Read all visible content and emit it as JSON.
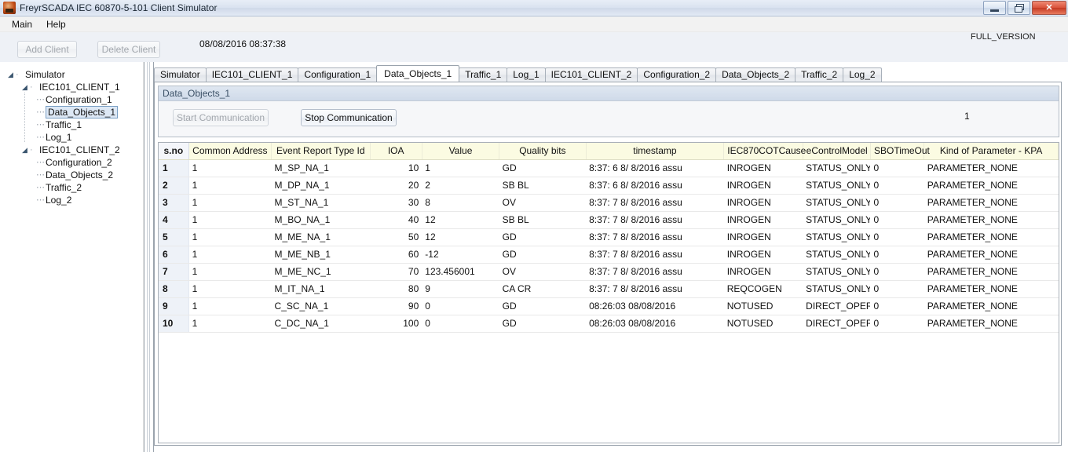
{
  "window": {
    "title": "FreyrSCADA IEC 60870-5-101 Client Simulator",
    "icon": "app-icon",
    "buttons": {
      "minimize": "minimize-icon",
      "restore": "restore-icon",
      "close": "✕"
    }
  },
  "menubar": {
    "items": [
      {
        "label": "Main"
      },
      {
        "label": "Help"
      }
    ]
  },
  "toolbar": {
    "add_client_label": "Add Client",
    "delete_client_label": "Delete Client",
    "datetime": "08/08/2016 08:37:38",
    "version_badge": "FULL_VERSION"
  },
  "tree": {
    "root": "Simulator",
    "nodes": [
      {
        "label": "Simulator",
        "level": 0,
        "expander": "◢",
        "selected": false
      },
      {
        "label": "IEC101_CLIENT_1",
        "level": 1,
        "expander": "◢",
        "selected": false
      },
      {
        "label": "Configuration_1",
        "level": 2,
        "expander": "",
        "selected": false
      },
      {
        "label": "Data_Objects_1",
        "level": 2,
        "expander": "",
        "selected": true
      },
      {
        "label": "Traffic_1",
        "level": 2,
        "expander": "",
        "selected": false
      },
      {
        "label": "Log_1",
        "level": 2,
        "expander": "",
        "selected": false
      },
      {
        "label": "IEC101_CLIENT_2",
        "level": 1,
        "expander": "◢",
        "selected": false
      },
      {
        "label": "Configuration_2",
        "level": 2,
        "expander": "",
        "selected": false
      },
      {
        "label": "Data_Objects_2",
        "level": 2,
        "expander": "",
        "selected": false
      },
      {
        "label": "Traffic_2",
        "level": 2,
        "expander": "",
        "selected": false
      },
      {
        "label": "Log_2",
        "level": 2,
        "expander": "",
        "selected": false
      }
    ]
  },
  "tabs": {
    "active": "Data_Objects_1",
    "items": [
      {
        "label": "Simulator",
        "active": false
      },
      {
        "label": "IEC101_CLIENT_1",
        "active": false
      },
      {
        "label": "Configuration_1",
        "active": false
      },
      {
        "label": "Data_Objects_1",
        "active": true
      },
      {
        "label": "Traffic_1",
        "active": false
      },
      {
        "label": "Log_1",
        "active": false
      },
      {
        "label": "IEC101_CLIENT_2",
        "active": false
      },
      {
        "label": "Configuration_2",
        "active": false
      },
      {
        "label": "Data_Objects_2",
        "active": false
      },
      {
        "label": "Traffic_2",
        "active": false
      },
      {
        "label": "Log_2",
        "active": false
      }
    ]
  },
  "panel": {
    "group_title": "Data_Objects_1",
    "start_button": "Start Communication",
    "start_button_disabled": true,
    "stop_button": "Stop Communication",
    "stop_button_disabled": false,
    "connection_count": "1"
  },
  "grid": {
    "columns": [
      "s.no",
      "Common Address",
      "Event Report Type Id",
      "IOA",
      "Value",
      "Quality bits",
      "timestamp",
      "IEC870COTCause",
      "eControlModel",
      "SBOTimeOut",
      "Kind of Parameter - KPA"
    ],
    "rows": [
      {
        "sno": "1",
        "ca": "1",
        "type": "M_SP_NA_1",
        "ioa": "10",
        "value": "1",
        "quality": "GD",
        "timestamp": "8:37: 6  8/ 8/2016 assu",
        "cot": "INROGEN",
        "ecm": "STATUS_ONLY",
        "sbo": "0",
        "kpa": "PARAMETER_NONE"
      },
      {
        "sno": "2",
        "ca": "1",
        "type": "M_DP_NA_1",
        "ioa": "20",
        "value": "2",
        "quality": "SB BL",
        "timestamp": "8:37: 6  8/ 8/2016 assu",
        "cot": "INROGEN",
        "ecm": "STATUS_ONLY",
        "sbo": "0",
        "kpa": "PARAMETER_NONE"
      },
      {
        "sno": "3",
        "ca": "1",
        "type": "M_ST_NA_1",
        "ioa": "30",
        "value": "8",
        "quality": "OV",
        "timestamp": "8:37: 7  8/ 8/2016 assu",
        "cot": "INROGEN",
        "ecm": "STATUS_ONLY",
        "sbo": "0",
        "kpa": "PARAMETER_NONE"
      },
      {
        "sno": "4",
        "ca": "1",
        "type": "M_BO_NA_1",
        "ioa": "40",
        "value": "12",
        "quality": "SB BL",
        "timestamp": "8:37: 7  8/ 8/2016 assu",
        "cot": "INROGEN",
        "ecm": "STATUS_ONLY",
        "sbo": "0",
        "kpa": "PARAMETER_NONE"
      },
      {
        "sno": "5",
        "ca": "1",
        "type": "M_ME_NA_1",
        "ioa": "50",
        "value": "12",
        "quality": "GD",
        "timestamp": "8:37: 7  8/ 8/2016 assu",
        "cot": "INROGEN",
        "ecm": "STATUS_ONLY",
        "sbo": "0",
        "kpa": "PARAMETER_NONE"
      },
      {
        "sno": "6",
        "ca": "1",
        "type": "M_ME_NB_1",
        "ioa": "60",
        "value": "-12",
        "quality": "GD",
        "timestamp": "8:37: 7  8/ 8/2016 assu",
        "cot": "INROGEN",
        "ecm": "STATUS_ONLY",
        "sbo": "0",
        "kpa": "PARAMETER_NONE"
      },
      {
        "sno": "7",
        "ca": "1",
        "type": "M_ME_NC_1",
        "ioa": "70",
        "value": "123.456001",
        "quality": "OV",
        "timestamp": "8:37: 7  8/ 8/2016 assu",
        "cot": "INROGEN",
        "ecm": "STATUS_ONLY",
        "sbo": "0",
        "kpa": "PARAMETER_NONE"
      },
      {
        "sno": "8",
        "ca": "1",
        "type": "M_IT_NA_1",
        "ioa": "80",
        "value": "9",
        "quality": "CA CR",
        "timestamp": "8:37: 7  8/ 8/2016 assu",
        "cot": "REQCOGEN",
        "ecm": "STATUS_ONLY",
        "sbo": "0",
        "kpa": "PARAMETER_NONE"
      },
      {
        "sno": "9",
        "ca": "1",
        "type": "C_SC_NA_1",
        "ioa": "90",
        "value": "0",
        "quality": "GD",
        "timestamp": "08:26:03 08/08/2016",
        "cot": "NOTUSED",
        "ecm": "DIRECT_OPER",
        "sbo": "0",
        "kpa": "PARAMETER_NONE"
      },
      {
        "sno": "10",
        "ca": "1",
        "type": "C_DC_NA_1",
        "ioa": "100",
        "value": "0",
        "quality": "GD",
        "timestamp": "08:26:03 08/08/2016",
        "cot": "NOTUSED",
        "ecm": "DIRECT_OPER",
        "sbo": "0",
        "kpa": "PARAMETER_NONE"
      }
    ]
  },
  "colors": {
    "header_yellow": "#fbfbe2",
    "sno_blue": "#eef2f8",
    "selection_blue": "#dde8f5",
    "close_red": "#d9513a"
  }
}
